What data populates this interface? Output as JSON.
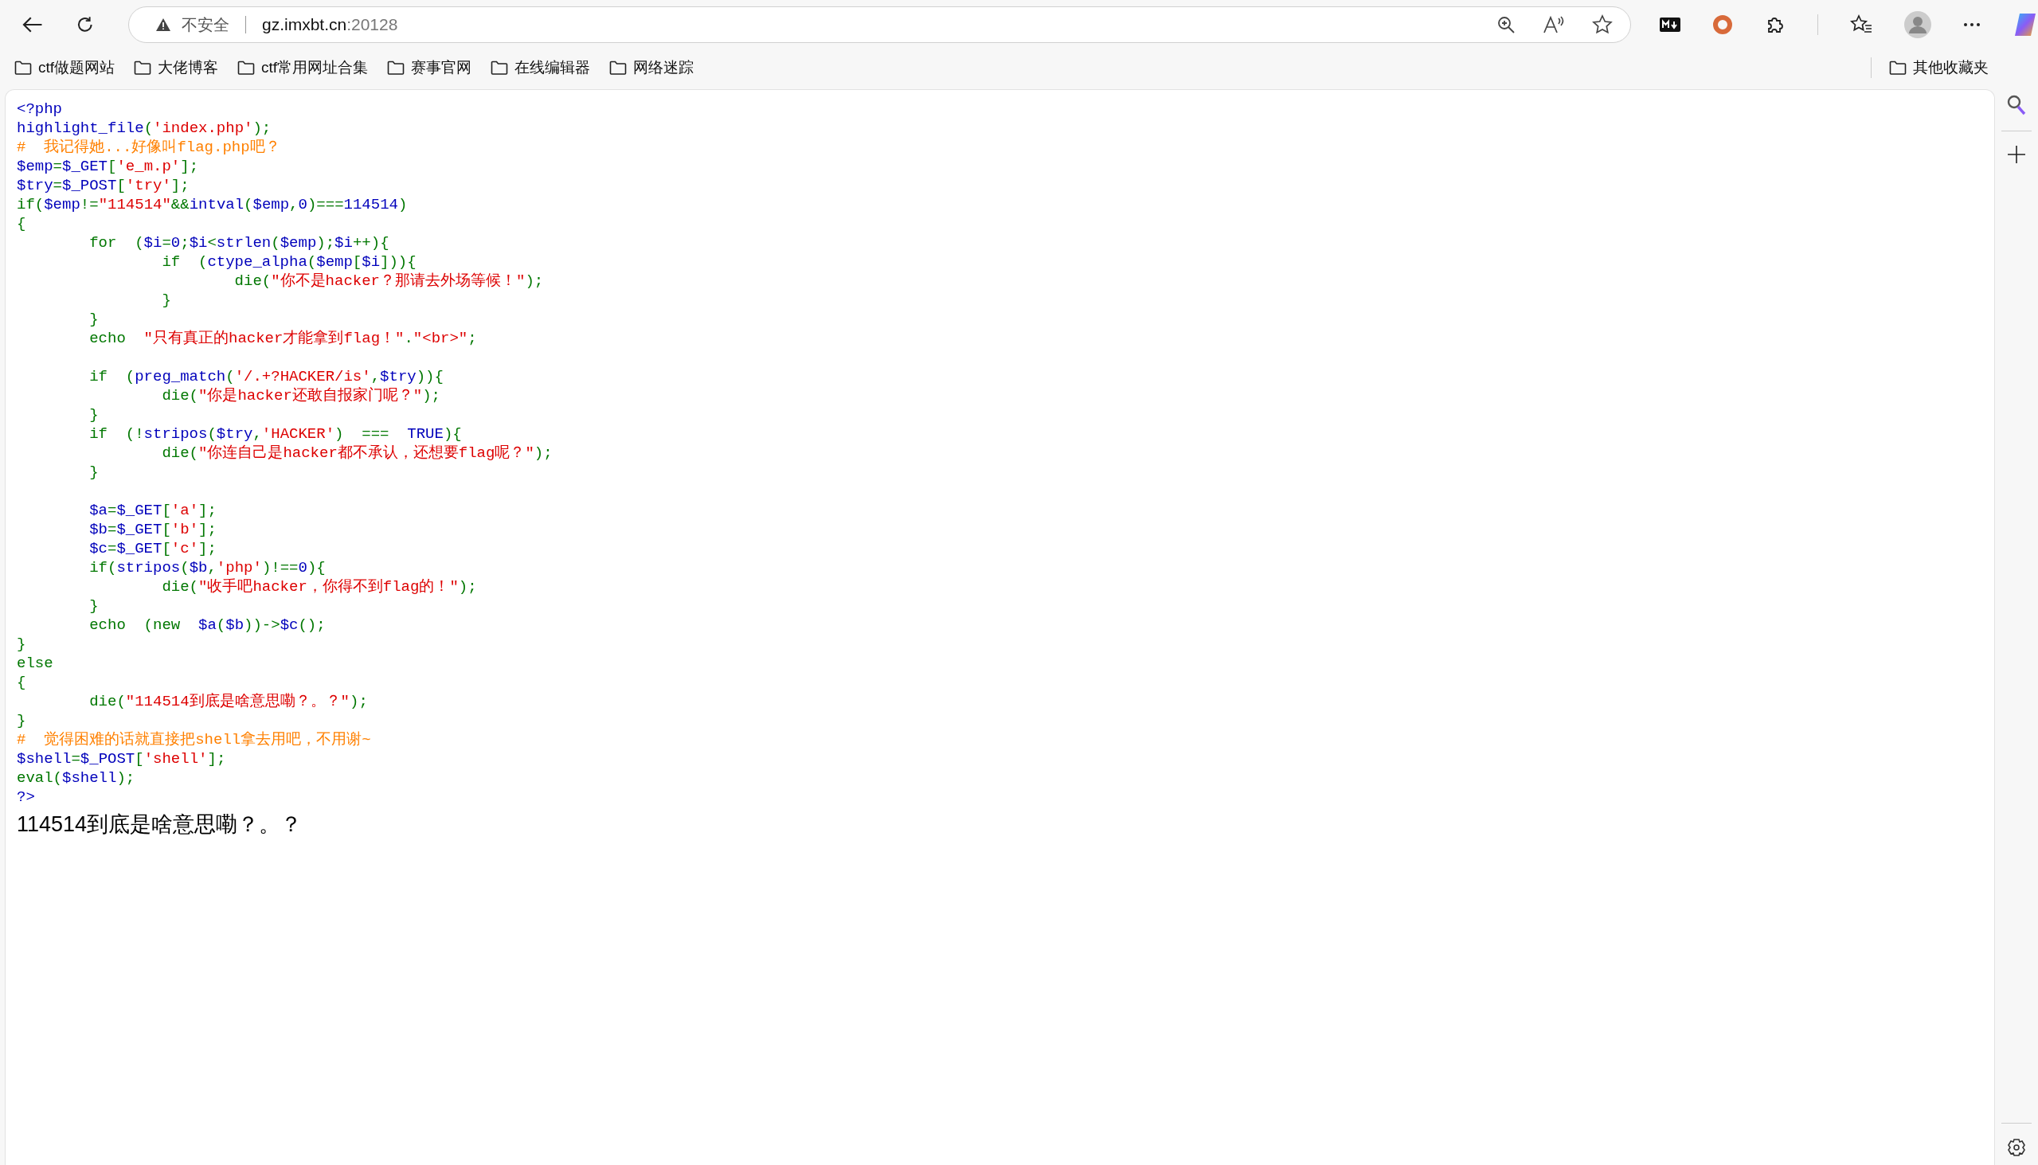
{
  "browser": {
    "address": {
      "security_label": "不安全",
      "host": "gz.imxbt.cn",
      "port": ":20128"
    },
    "bookmarks": [
      {
        "label": "ctf做题网站"
      },
      {
        "label": "大佬博客"
      },
      {
        "label": "ctf常用网址合集"
      },
      {
        "label": "赛事官网"
      },
      {
        "label": "在线编辑器"
      },
      {
        "label": "网络迷踪"
      }
    ],
    "other_bookmarks": "其他收藏夹"
  },
  "page": {
    "source_lines": [
      {
        "kind": "code",
        "tokens": [
          {
            "kind": "default",
            "text": "<?php"
          }
        ]
      },
      {
        "kind": "code",
        "tokens": [
          {
            "kind": "default",
            "text": "highlight_file"
          },
          {
            "kind": "keyword",
            "text": "("
          },
          {
            "kind": "string",
            "text": "'index.php'"
          },
          {
            "kind": "keyword",
            "text": ");"
          }
        ]
      },
      {
        "kind": "code",
        "tokens": [
          {
            "kind": "comment",
            "text": "#  我记得她...好像叫flag.php吧？"
          }
        ]
      },
      {
        "kind": "code",
        "tokens": [
          {
            "kind": "default",
            "text": "$emp"
          },
          {
            "kind": "keyword",
            "text": "="
          },
          {
            "kind": "default",
            "text": "$_GET"
          },
          {
            "kind": "keyword",
            "text": "["
          },
          {
            "kind": "string",
            "text": "'e_m.p'"
          },
          {
            "kind": "keyword",
            "text": "];"
          }
        ]
      },
      {
        "kind": "code",
        "tokens": [
          {
            "kind": "default",
            "text": "$try"
          },
          {
            "kind": "keyword",
            "text": "="
          },
          {
            "kind": "default",
            "text": "$_POST"
          },
          {
            "kind": "keyword",
            "text": "["
          },
          {
            "kind": "string",
            "text": "'try'"
          },
          {
            "kind": "keyword",
            "text": "];"
          }
        ]
      },
      {
        "kind": "code",
        "tokens": [
          {
            "kind": "keyword",
            "text": "if("
          },
          {
            "kind": "default",
            "text": "$emp"
          },
          {
            "kind": "keyword",
            "text": "!="
          },
          {
            "kind": "string",
            "text": "\"114514\""
          },
          {
            "kind": "keyword",
            "text": "&&"
          },
          {
            "kind": "default",
            "text": "intval"
          },
          {
            "kind": "keyword",
            "text": "("
          },
          {
            "kind": "default",
            "text": "$emp"
          },
          {
            "kind": "keyword",
            "text": ","
          },
          {
            "kind": "default",
            "text": "0"
          },
          {
            "kind": "keyword",
            "text": ")==="
          },
          {
            "kind": "default",
            "text": "114514"
          },
          {
            "kind": "keyword",
            "text": ")"
          }
        ]
      },
      {
        "kind": "code",
        "tokens": [
          {
            "kind": "keyword",
            "text": "{"
          }
        ]
      },
      {
        "kind": "code",
        "tokens": [
          {
            "kind": "keyword",
            "text": "        for  ("
          },
          {
            "kind": "default",
            "text": "$i"
          },
          {
            "kind": "keyword",
            "text": "="
          },
          {
            "kind": "default",
            "text": "0"
          },
          {
            "kind": "keyword",
            "text": ";"
          },
          {
            "kind": "default",
            "text": "$i"
          },
          {
            "kind": "keyword",
            "text": "<"
          },
          {
            "kind": "default",
            "text": "strlen"
          },
          {
            "kind": "keyword",
            "text": "("
          },
          {
            "kind": "default",
            "text": "$emp"
          },
          {
            "kind": "keyword",
            "text": ");"
          },
          {
            "kind": "default",
            "text": "$i"
          },
          {
            "kind": "keyword",
            "text": "++){"
          }
        ]
      },
      {
        "kind": "code",
        "tokens": [
          {
            "kind": "keyword",
            "text": "                if  ("
          },
          {
            "kind": "default",
            "text": "ctype_alpha"
          },
          {
            "kind": "keyword",
            "text": "("
          },
          {
            "kind": "default",
            "text": "$emp"
          },
          {
            "kind": "keyword",
            "text": "["
          },
          {
            "kind": "default",
            "text": "$i"
          },
          {
            "kind": "keyword",
            "text": "])){"
          }
        ]
      },
      {
        "kind": "code",
        "tokens": [
          {
            "kind": "keyword",
            "text": "                        die("
          },
          {
            "kind": "string",
            "text": "\"你不是hacker？那请去外场等候！\""
          },
          {
            "kind": "keyword",
            "text": ");"
          }
        ]
      },
      {
        "kind": "code",
        "tokens": [
          {
            "kind": "keyword",
            "text": "                }"
          }
        ]
      },
      {
        "kind": "code",
        "tokens": [
          {
            "kind": "keyword",
            "text": "        }"
          }
        ]
      },
      {
        "kind": "code",
        "tokens": [
          {
            "kind": "keyword",
            "text": "        echo  "
          },
          {
            "kind": "string",
            "text": "\"只有真正的hacker才能拿到flag！\""
          },
          {
            "kind": "keyword",
            "text": "."
          },
          {
            "kind": "string",
            "text": "\"<br>\""
          },
          {
            "kind": "keyword",
            "text": ";"
          }
        ]
      },
      {
        "kind": "blank"
      },
      {
        "kind": "code",
        "tokens": [
          {
            "kind": "keyword",
            "text": "        if  ("
          },
          {
            "kind": "default",
            "text": "preg_match"
          },
          {
            "kind": "keyword",
            "text": "("
          },
          {
            "kind": "string",
            "text": "'/.+?HACKER/is'"
          },
          {
            "kind": "keyword",
            "text": ","
          },
          {
            "kind": "default",
            "text": "$try"
          },
          {
            "kind": "keyword",
            "text": ")){"
          }
        ]
      },
      {
        "kind": "code",
        "tokens": [
          {
            "kind": "keyword",
            "text": "                die("
          },
          {
            "kind": "string",
            "text": "\"你是hacker还敢自报家门呢？\""
          },
          {
            "kind": "keyword",
            "text": ");"
          }
        ]
      },
      {
        "kind": "code",
        "tokens": [
          {
            "kind": "keyword",
            "text": "        }"
          }
        ]
      },
      {
        "kind": "code",
        "tokens": [
          {
            "kind": "keyword",
            "text": "        if  (!"
          },
          {
            "kind": "default",
            "text": "stripos"
          },
          {
            "kind": "keyword",
            "text": "("
          },
          {
            "kind": "default",
            "text": "$try"
          },
          {
            "kind": "keyword",
            "text": ","
          },
          {
            "kind": "string",
            "text": "'HACKER'"
          },
          {
            "kind": "keyword",
            "text": ")  ===  "
          },
          {
            "kind": "default",
            "text": "TRUE"
          },
          {
            "kind": "keyword",
            "text": "){"
          }
        ]
      },
      {
        "kind": "code",
        "tokens": [
          {
            "kind": "keyword",
            "text": "                die("
          },
          {
            "kind": "string",
            "text": "\"你连自己是hacker都不承认，还想要flag呢？\""
          },
          {
            "kind": "keyword",
            "text": ");"
          }
        ]
      },
      {
        "kind": "code",
        "tokens": [
          {
            "kind": "keyword",
            "text": "        }"
          }
        ]
      },
      {
        "kind": "blank"
      },
      {
        "kind": "code",
        "tokens": [
          {
            "kind": "default",
            "text": "        $a"
          },
          {
            "kind": "keyword",
            "text": "="
          },
          {
            "kind": "default",
            "text": "$_GET"
          },
          {
            "kind": "keyword",
            "text": "["
          },
          {
            "kind": "string",
            "text": "'a'"
          },
          {
            "kind": "keyword",
            "text": "];"
          }
        ]
      },
      {
        "kind": "code",
        "tokens": [
          {
            "kind": "default",
            "text": "        $b"
          },
          {
            "kind": "keyword",
            "text": "="
          },
          {
            "kind": "default",
            "text": "$_GET"
          },
          {
            "kind": "keyword",
            "text": "["
          },
          {
            "kind": "string",
            "text": "'b'"
          },
          {
            "kind": "keyword",
            "text": "];"
          }
        ]
      },
      {
        "kind": "code",
        "tokens": [
          {
            "kind": "default",
            "text": "        $c"
          },
          {
            "kind": "keyword",
            "text": "="
          },
          {
            "kind": "default",
            "text": "$_GET"
          },
          {
            "kind": "keyword",
            "text": "["
          },
          {
            "kind": "string",
            "text": "'c'"
          },
          {
            "kind": "keyword",
            "text": "];"
          }
        ]
      },
      {
        "kind": "code",
        "tokens": [
          {
            "kind": "keyword",
            "text": "        if("
          },
          {
            "kind": "default",
            "text": "stripos"
          },
          {
            "kind": "keyword",
            "text": "("
          },
          {
            "kind": "default",
            "text": "$b"
          },
          {
            "kind": "keyword",
            "text": ","
          },
          {
            "kind": "string",
            "text": "'php'"
          },
          {
            "kind": "keyword",
            "text": ")!=="
          },
          {
            "kind": "default",
            "text": "0"
          },
          {
            "kind": "keyword",
            "text": "){"
          }
        ]
      },
      {
        "kind": "code",
        "tokens": [
          {
            "kind": "keyword",
            "text": "                die("
          },
          {
            "kind": "string",
            "text": "\"收手吧hacker，你得不到flag的！\""
          },
          {
            "kind": "keyword",
            "text": ");"
          }
        ]
      },
      {
        "kind": "code",
        "tokens": [
          {
            "kind": "keyword",
            "text": "        }"
          }
        ]
      },
      {
        "kind": "code",
        "tokens": [
          {
            "kind": "keyword",
            "text": "        echo  (new  "
          },
          {
            "kind": "default",
            "text": "$a"
          },
          {
            "kind": "keyword",
            "text": "("
          },
          {
            "kind": "default",
            "text": "$b"
          },
          {
            "kind": "keyword",
            "text": "))->"
          },
          {
            "kind": "default",
            "text": "$c"
          },
          {
            "kind": "keyword",
            "text": "();"
          }
        ]
      },
      {
        "kind": "code",
        "tokens": [
          {
            "kind": "keyword",
            "text": "}"
          }
        ]
      },
      {
        "kind": "code",
        "tokens": [
          {
            "kind": "keyword",
            "text": "else"
          }
        ]
      },
      {
        "kind": "code",
        "tokens": [
          {
            "kind": "keyword",
            "text": "{"
          }
        ]
      },
      {
        "kind": "code",
        "tokens": [
          {
            "kind": "keyword",
            "text": "        die("
          },
          {
            "kind": "string",
            "text": "\"114514到底是啥意思嘞？。？\""
          },
          {
            "kind": "keyword",
            "text": ");"
          }
        ]
      },
      {
        "kind": "code",
        "tokens": [
          {
            "kind": "keyword",
            "text": "}"
          }
        ]
      },
      {
        "kind": "code",
        "tokens": [
          {
            "kind": "comment",
            "text": "#  觉得困难的话就直接把shell拿去用吧，不用谢~"
          }
        ]
      },
      {
        "kind": "code",
        "tokens": [
          {
            "kind": "default",
            "text": "$shell"
          },
          {
            "kind": "keyword",
            "text": "="
          },
          {
            "kind": "default",
            "text": "$_POST"
          },
          {
            "kind": "keyword",
            "text": "["
          },
          {
            "kind": "string",
            "text": "'shell'"
          },
          {
            "kind": "keyword",
            "text": "];"
          }
        ]
      },
      {
        "kind": "code",
        "tokens": [
          {
            "kind": "keyword",
            "text": "eval("
          },
          {
            "kind": "default",
            "text": "$shell"
          },
          {
            "kind": "keyword",
            "text": ");"
          }
        ]
      },
      {
        "kind": "code",
        "tokens": [
          {
            "kind": "default",
            "text": "?>"
          }
        ]
      }
    ],
    "output": "114514到底是啥意思嘞？。？"
  }
}
